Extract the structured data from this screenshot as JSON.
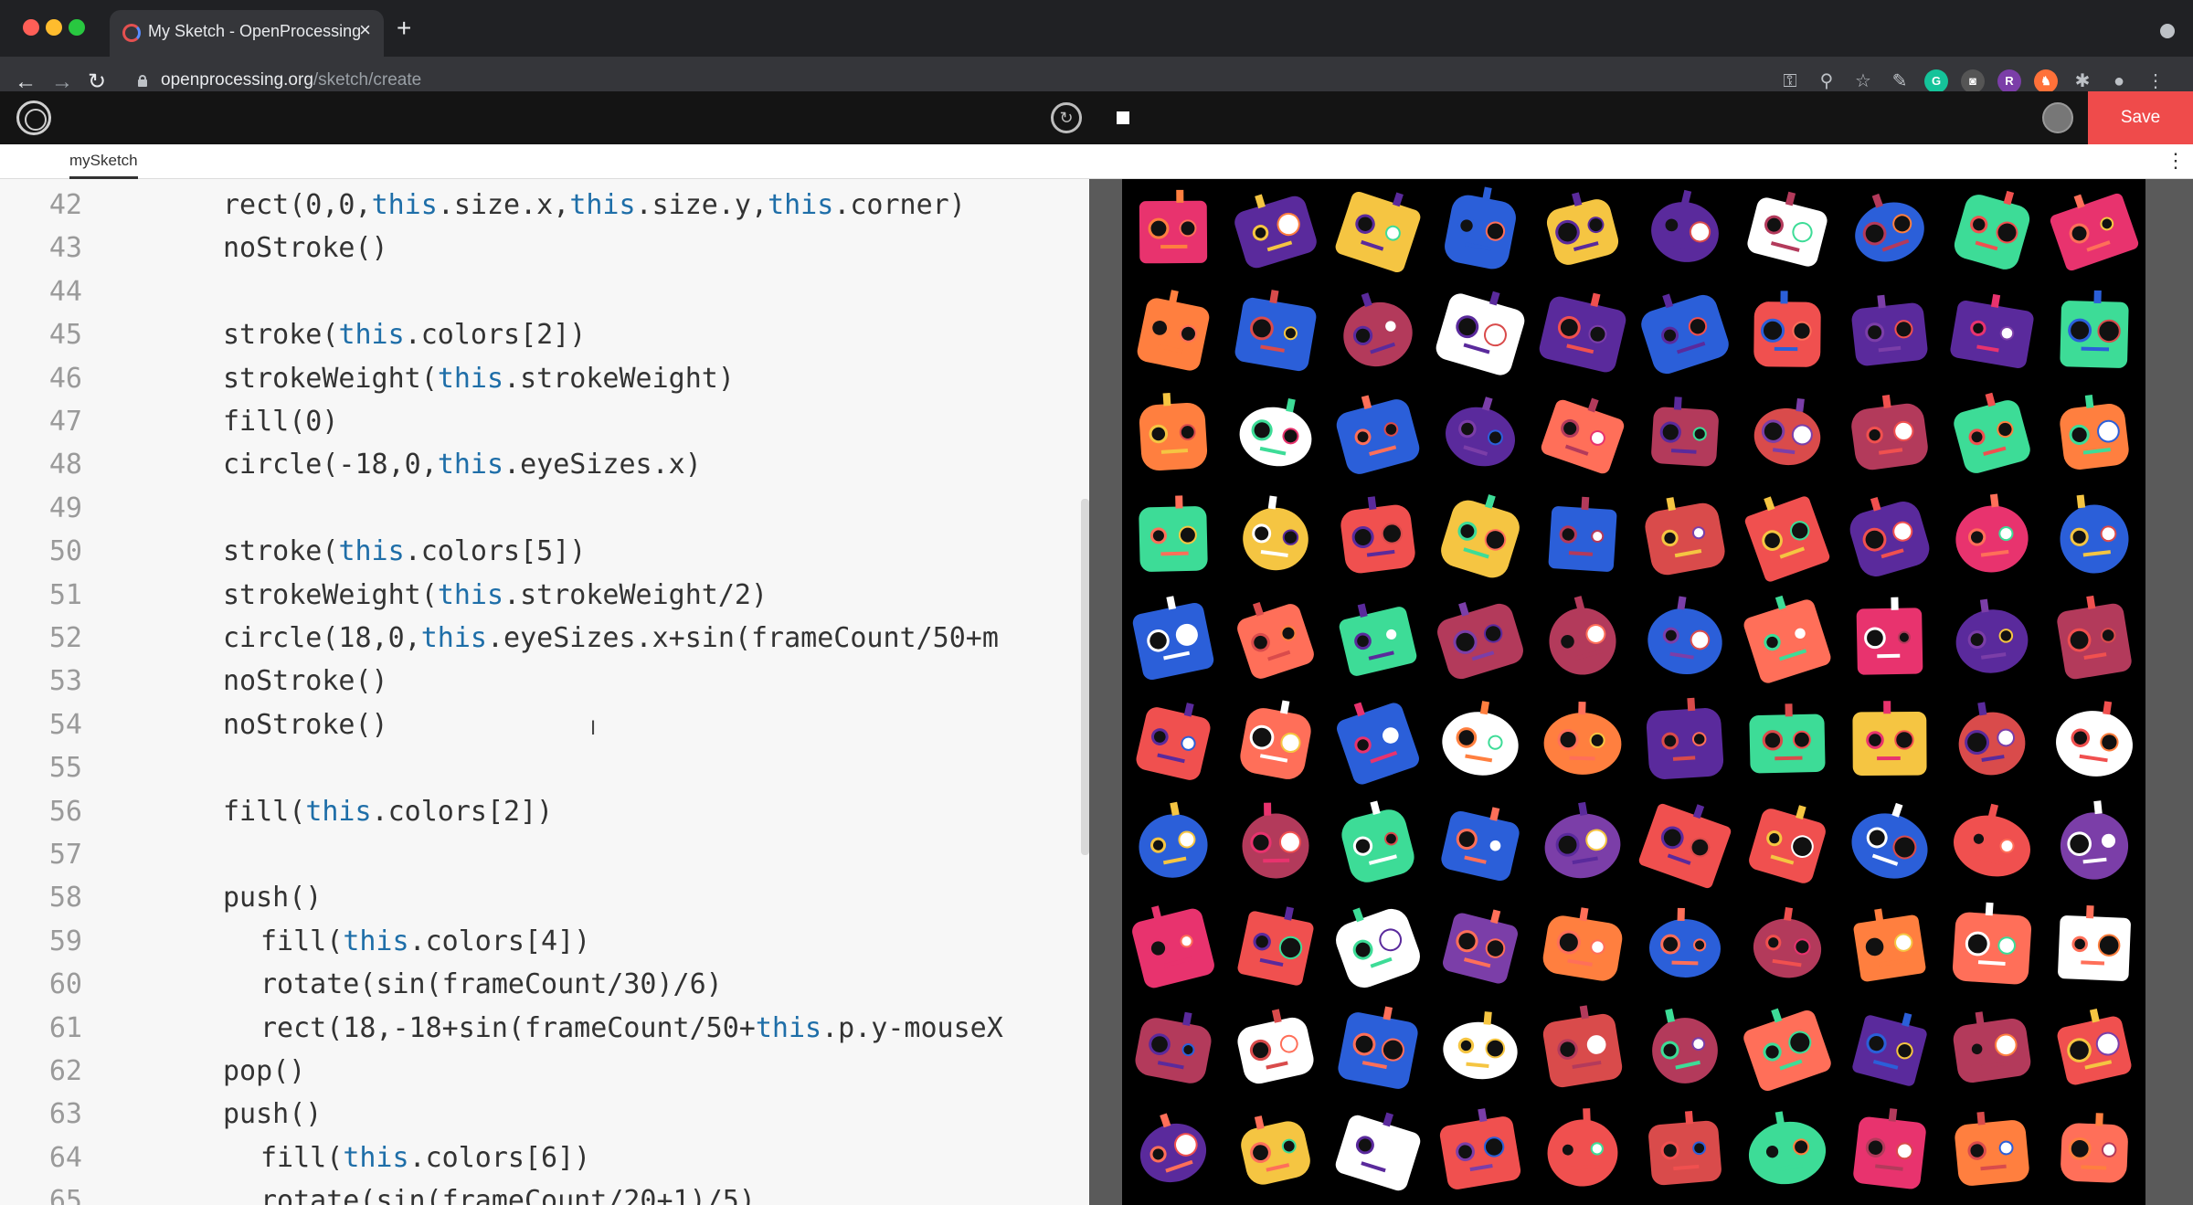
{
  "browser": {
    "tab_title": "My Sketch - OpenProcessing",
    "tab_close": "×",
    "new_tab": "+",
    "url_host": "openprocessing.org",
    "url_path": "/sketch/create",
    "nav_back": "←",
    "nav_forward": "→",
    "nav_reload": "↻",
    "extensions": [
      {
        "name": "key-icon",
        "glyph": "⚿"
      },
      {
        "name": "zoom-icon",
        "glyph": "⚲"
      },
      {
        "name": "star-icon",
        "glyph": "☆"
      },
      {
        "name": "pen-extension-icon",
        "glyph": "✎"
      },
      {
        "name": "grammarly-extension-icon",
        "glyph": "G"
      },
      {
        "name": "camera-extension-icon",
        "glyph": "◙"
      },
      {
        "name": "r-extension-icon",
        "glyph": "R"
      },
      {
        "name": "fox-extension-icon",
        "glyph": "♞"
      },
      {
        "name": "puzzle-extension-icon",
        "glyph": "✱"
      },
      {
        "name": "profile-icon",
        "glyph": "●"
      },
      {
        "name": "more-menu-icon",
        "glyph": "⋮"
      }
    ]
  },
  "toolbar": {
    "save_label": "Save",
    "restart_glyph": "↻"
  },
  "file_tabs": {
    "active": "mySketch",
    "menu_glyph": "⋮"
  },
  "editor": {
    "lines": [
      {
        "n": "42",
        "code": "rect(0,0,this.size.x,this.size.y,this.corner)",
        "indent": 1
      },
      {
        "n": "43",
        "code": "noStroke()",
        "indent": 1
      },
      {
        "n": "44",
        "code": "",
        "indent": 1
      },
      {
        "n": "45",
        "code": "stroke(this.colors[2])",
        "indent": 1
      },
      {
        "n": "46",
        "code": "strokeWeight(this.strokeWeight)",
        "indent": 1
      },
      {
        "n": "47",
        "code": "fill(0)",
        "indent": 1
      },
      {
        "n": "48",
        "code": "circle(-18,0,this.eyeSizes.x)",
        "indent": 1
      },
      {
        "n": "49",
        "code": "",
        "indent": 1
      },
      {
        "n": "50",
        "code": "stroke(this.colors[5])",
        "indent": 1
      },
      {
        "n": "51",
        "code": "strokeWeight(this.strokeWeight/2)",
        "indent": 1
      },
      {
        "n": "52",
        "code": "circle(18,0,this.eyeSizes.x+sin(frameCount/50+m",
        "indent": 1
      },
      {
        "n": "53",
        "code": "noStroke()",
        "indent": 1
      },
      {
        "n": "54",
        "code": "noStroke()",
        "indent": 1
      },
      {
        "n": "55",
        "code": "",
        "indent": 1
      },
      {
        "n": "56",
        "code": "fill(this.colors[2])",
        "indent": 1
      },
      {
        "n": "57",
        "code": "",
        "indent": 1
      },
      {
        "n": "58",
        "code": "push()",
        "indent": 1
      },
      {
        "n": "59",
        "code": "fill(this.colors[4])",
        "indent": 2
      },
      {
        "n": "60",
        "code": "rotate(sin(frameCount/30)/6)",
        "indent": 2
      },
      {
        "n": "61",
        "code": "rect(18,-18+sin(frameCount/50+this.p.y-mouseX",
        "indent": 2
      },
      {
        "n": "62",
        "code": "pop()",
        "indent": 1
      },
      {
        "n": "63",
        "code": "push()",
        "indent": 1
      },
      {
        "n": "64",
        "code": "fill(this.colors[6])",
        "indent": 2
      },
      {
        "n": "65",
        "code": "rotate(sin(frameCount/20+1)/5)",
        "indent": 2
      }
    ]
  },
  "preview": {
    "background": "#000000",
    "palette": [
      "#f0504f",
      "#ff7f3f",
      "#f5c542",
      "#3ddc97",
      "#2b5fd9",
      "#5a2a9c",
      "#e8336e",
      "#b33a5b",
      "#ffffff",
      "#ff6f59",
      "#7b3ea8",
      "#d94b4b"
    ]
  }
}
